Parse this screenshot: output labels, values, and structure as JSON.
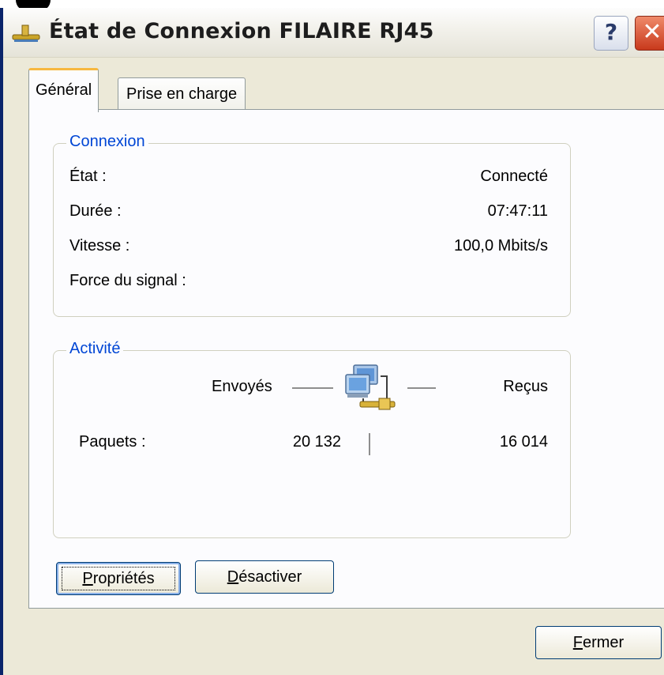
{
  "window": {
    "title": "État de Connexion FILAIRE RJ45",
    "help_label": "?",
    "close_label": "✕"
  },
  "tabs": [
    {
      "label": "Général",
      "active": true
    },
    {
      "label": "Prise en charge",
      "active": false
    }
  ],
  "connection": {
    "legend": "Connexion",
    "rows": [
      {
        "label": "État :",
        "value": "Connecté"
      },
      {
        "label": "Durée :",
        "value": "07:47:11"
      },
      {
        "label": "Vitesse :",
        "value": "100,0 Mbits/s"
      },
      {
        "label": "Force du signal :",
        "value": ""
      }
    ]
  },
  "activity": {
    "legend": "Activité",
    "sent_label": "Envoyés",
    "received_label": "Reçus",
    "packets_label": "Paquets :",
    "packets_sent": "20 132",
    "packets_received": "16 014",
    "icon": "network-computers-icon"
  },
  "buttons": {
    "properties": {
      "mnemonic": "P",
      "rest": "ropriétés"
    },
    "disable": {
      "mnemonic": "D",
      "rest": "ésactiver"
    },
    "close": {
      "mnemonic": "F",
      "rest": "ermer"
    }
  }
}
